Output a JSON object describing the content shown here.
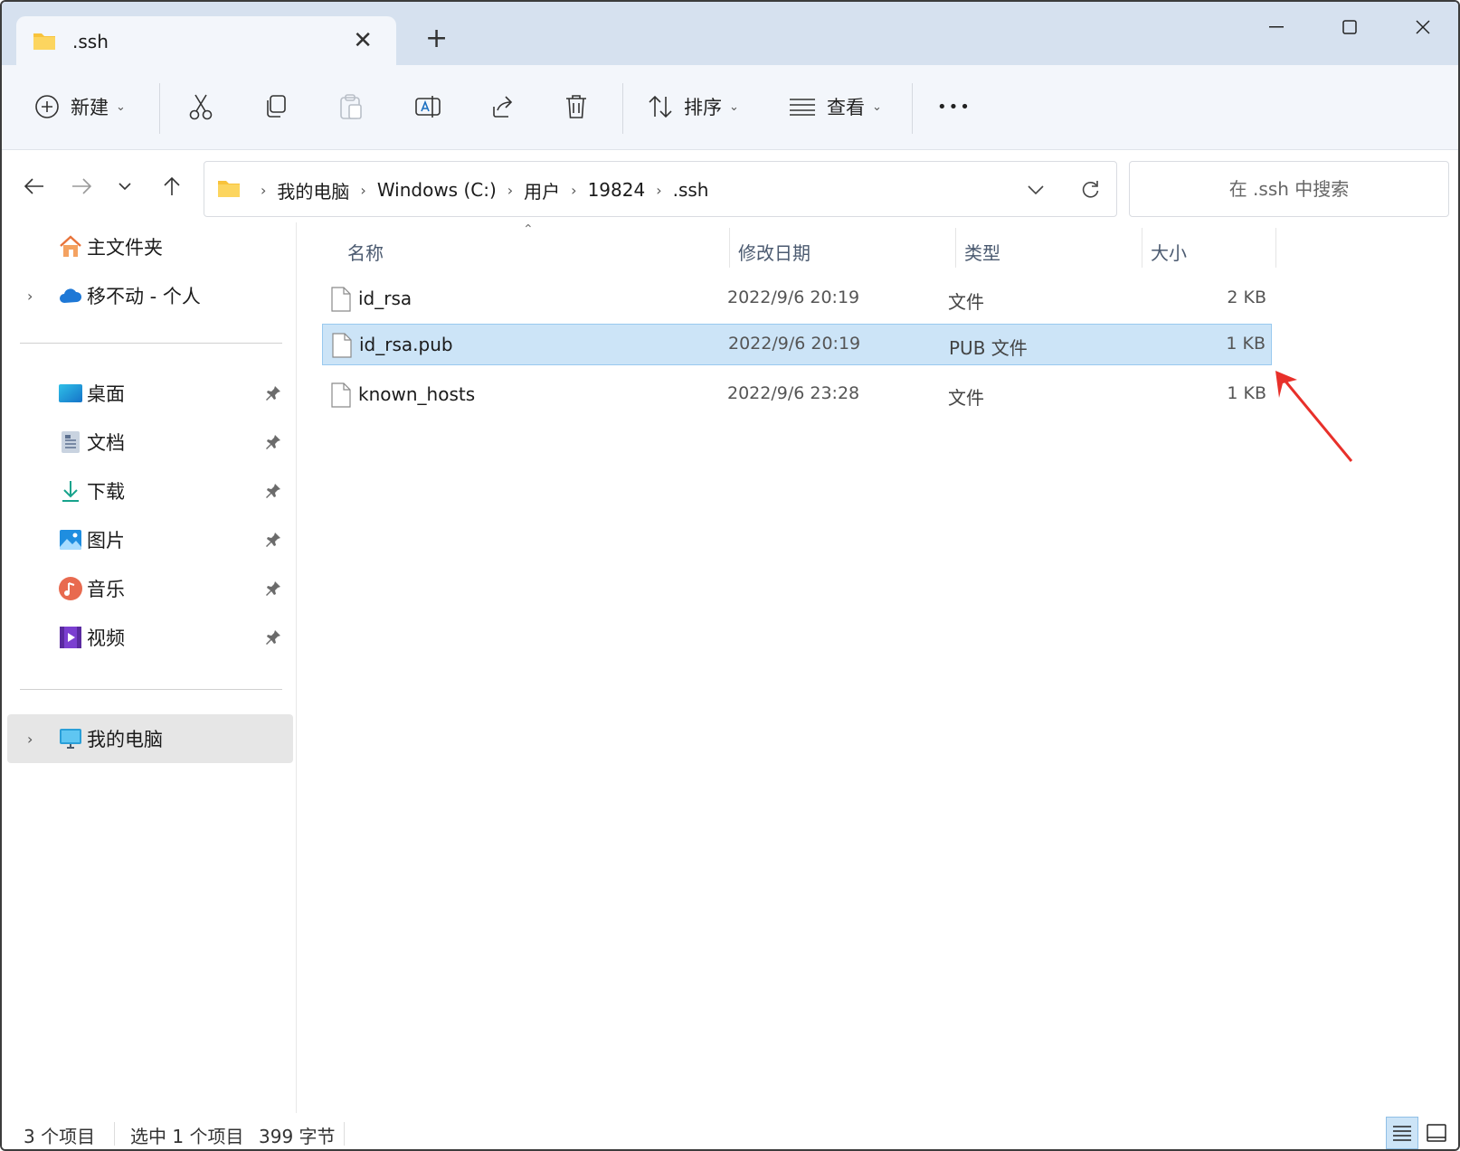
{
  "window": {
    "tab_title": ".ssh",
    "new_tab_glyph": "+",
    "controls": {
      "minimize": "—",
      "maximize": "☐",
      "close": "✕"
    }
  },
  "toolbar": {
    "new_label": "新建",
    "sort_label": "排序",
    "view_label": "查看",
    "more_label": "•••",
    "icons": [
      "add-circle-icon",
      "cut-icon",
      "copy-icon",
      "paste-icon",
      "rename-icon",
      "share-icon",
      "delete-icon",
      "sort-icon",
      "view-icon",
      "more-icon"
    ]
  },
  "address": {
    "crumbs": [
      "我的电脑",
      "Windows (C:)",
      "用户",
      "19824",
      ".ssh"
    ],
    "separator": "›"
  },
  "search": {
    "placeholder": "在 .ssh 中搜索"
  },
  "sidebar": {
    "top_items": [
      {
        "label": "主文件夹",
        "icon": "home-icon"
      },
      {
        "label": "移不动 - 个人",
        "icon": "cloud-icon"
      }
    ],
    "quick_access": [
      {
        "label": "桌面",
        "icon": "desktop-icon"
      },
      {
        "label": "文档",
        "icon": "document-icon"
      },
      {
        "label": "下载",
        "icon": "download-icon"
      },
      {
        "label": "图片",
        "icon": "pictures-icon"
      },
      {
        "label": "音乐",
        "icon": "music-icon"
      },
      {
        "label": "视频",
        "icon": "video-icon"
      }
    ],
    "this_pc": {
      "label": "我的电脑",
      "icon": "computer-icon"
    }
  },
  "columns": {
    "name": "名称",
    "modified": "修改日期",
    "type": "类型",
    "size": "大小"
  },
  "files": [
    {
      "name": "id_rsa",
      "modified": "2022/9/6 20:19",
      "type": "文件",
      "size": "2 KB",
      "selected": false
    },
    {
      "name": "id_rsa.pub",
      "modified": "2022/9/6 20:19",
      "type": "PUB 文件",
      "size": "1 KB",
      "selected": true
    },
    {
      "name": "known_hosts",
      "modified": "2022/9/6 23:28",
      "type": "文件",
      "size": "1 KB",
      "selected": false
    }
  ],
  "status": {
    "item_count": "3 个项目",
    "selection": "选中 1 个项目",
    "bytes": "399 字节"
  },
  "colors": {
    "titlebar": "#d6e1ef",
    "toolbar": "#f3f6fb",
    "selection": "#cce4f7",
    "selection_border": "#99c9ef",
    "annotation_arrow": "#e8302a"
  }
}
